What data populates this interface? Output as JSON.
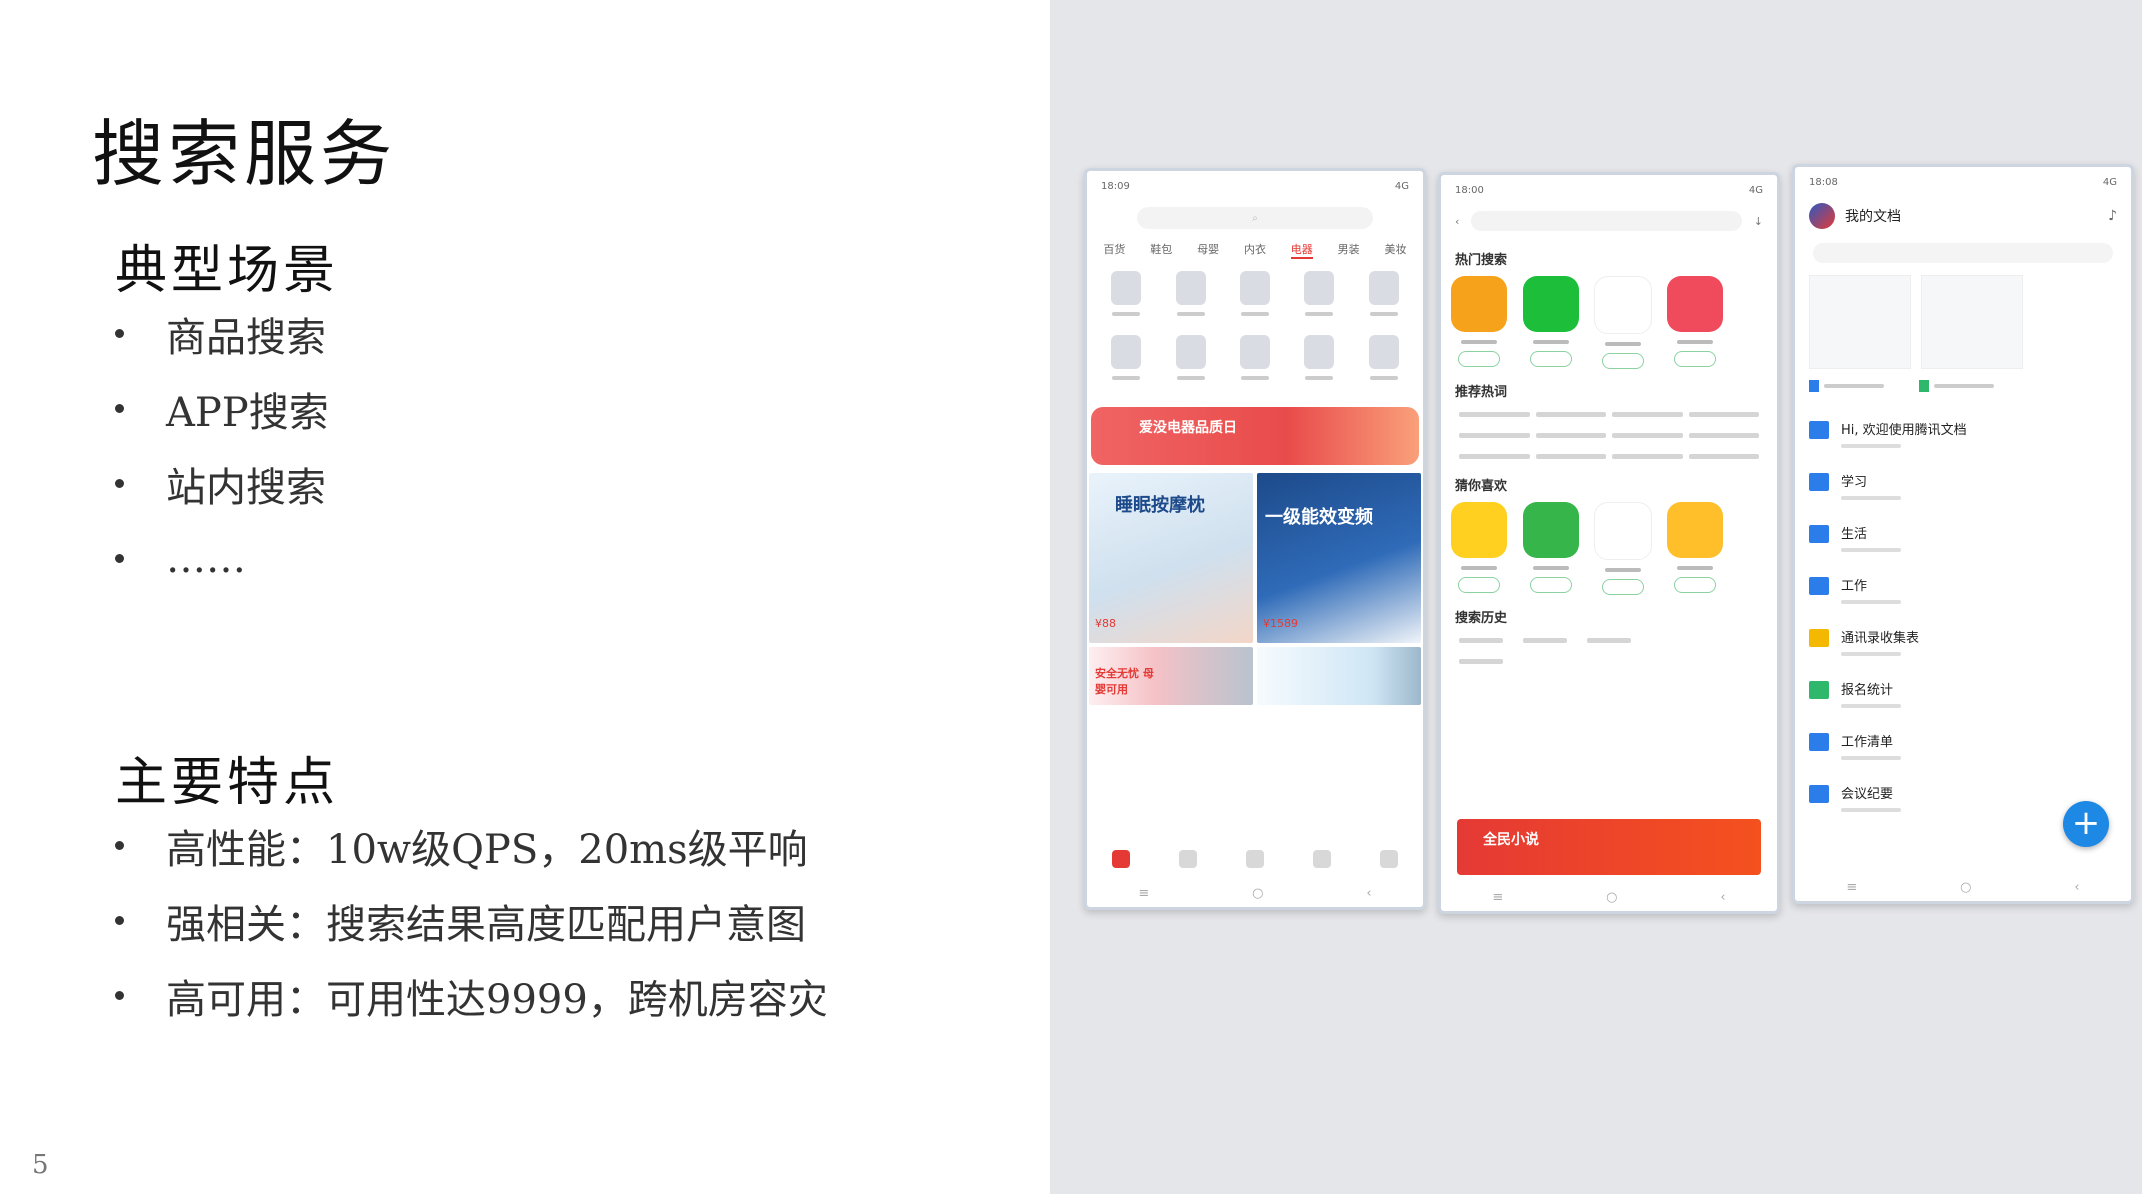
{
  "slide": {
    "title": "搜索服务",
    "section1": {
      "heading": "典型场景",
      "items": [
        "商品搜索",
        "APP搜索",
        "站内搜索",
        "……"
      ]
    },
    "section2": {
      "heading": "主要特点",
      "items": [
        "高性能：10w级QPS，20ms级平响",
        "强相关：搜索结果高度匹配用户意图",
        "高可用：可用性达9999，跨机房容灾"
      ]
    },
    "page_number": "5"
  },
  "phones": {
    "shop": {
      "status_time": "18:09",
      "status_right": "4G",
      "categories": [
        "百货",
        "鞋包",
        "母婴",
        "内衣",
        "电器",
        "男装",
        "美妆"
      ],
      "active_category": "电器",
      "banner_text": "爱没电器品质日",
      "tile1_text": "睡眠按摩枕",
      "tile2_text": "一级能效变频",
      "tile3_text": "安全无忧 母婴可用",
      "price1": "¥88",
      "price2": "¥1589"
    },
    "appstore": {
      "status_time": "18:00",
      "status_right": "4G",
      "hot_search": "热门搜索",
      "recommend": "推荐热词",
      "guess": "猜你喜欢",
      "history": "搜索历史",
      "banner_text": "全民小说"
    },
    "docs": {
      "status_time": "18:08",
      "status_right": "4G",
      "header": "我的文档",
      "files": [
        "Hi, 欢迎使用腾讯文档",
        "学习",
        "生活",
        "工作",
        "通讯录收集表",
        "报名统计",
        "工作清单",
        "会议纪要"
      ],
      "fab": "+"
    }
  },
  "colors": {
    "accent_red": "#e53935",
    "docs_blue": "#1e88e5",
    "right_panel_bg": "#e5e6e9"
  }
}
